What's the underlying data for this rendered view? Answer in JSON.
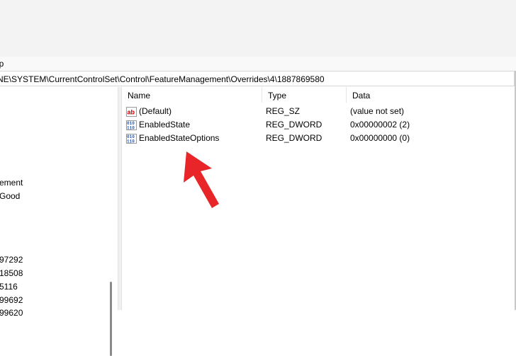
{
  "menu": {
    "help_fragment": "lp"
  },
  "address": {
    "path": "NE\\SYSTEM\\CurrentControlSet\\Control\\FeatureManagement\\Overrides\\4\\1887869580"
  },
  "tree": {
    "items": [
      "ement",
      "Good",
      "97292",
      "18508",
      "5116",
      "99692",
      "99620"
    ]
  },
  "list": {
    "columns": {
      "name": "Name",
      "type": "Type",
      "data": "Data"
    },
    "rows": [
      {
        "icon": "string-value-icon",
        "name": "(Default)",
        "type": "REG_SZ",
        "data": "(value not set)"
      },
      {
        "icon": "dword-value-icon",
        "name": "EnabledState",
        "type": "REG_DWORD",
        "data": "0x00000002 (2)"
      },
      {
        "icon": "dword-value-icon",
        "name": "EnabledStateOptions",
        "type": "REG_DWORD",
        "data": "0x00000000 (0)"
      }
    ]
  },
  "colors": {
    "arrow": "#e8262a",
    "accent": "#c00000",
    "dword_blue": "#2a5db0"
  }
}
